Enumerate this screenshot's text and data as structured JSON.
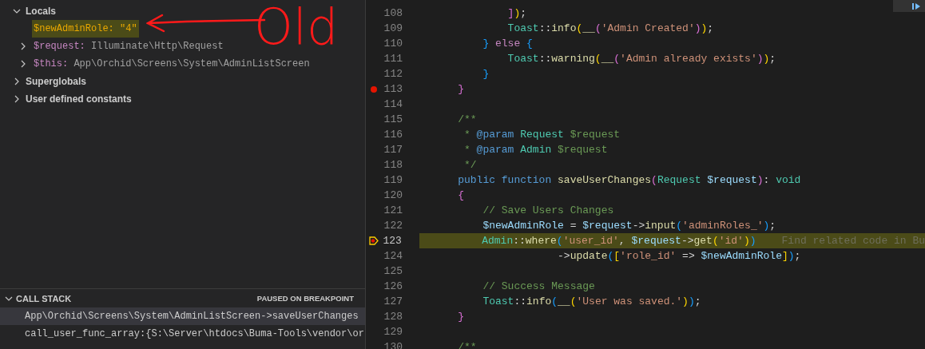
{
  "variables": {
    "sections": [
      {
        "label": "Locals",
        "expanded": true,
        "children": [
          {
            "name": "$newAdminRole:",
            "value": "\"4\"",
            "kind": "string",
            "expandable": false,
            "changed": true
          },
          {
            "name": "$request:",
            "value": "Illuminate\\Http\\Request",
            "kind": "object",
            "expandable": true,
            "changed": false
          },
          {
            "name": "$this:",
            "value": "App\\Orchid\\Screens\\System\\AdminListScreen",
            "kind": "object",
            "expandable": true,
            "changed": false
          }
        ]
      },
      {
        "label": "Superglobals",
        "expanded": false
      },
      {
        "label": "User defined constants",
        "expanded": false
      }
    ]
  },
  "annotation": {
    "text": "Old"
  },
  "call_stack": {
    "title": "CALL STACK",
    "expanded": true,
    "status": "PAUSED ON BREAKPOINT",
    "frames": [
      {
        "label": "App\\Orchid\\Screens\\System\\AdminListScreen->saveUserChanges",
        "selected": true
      },
      {
        "label": "call_user_func_array:{S:\\Server\\htdocs\\Buma-Tools\\vendor\\or",
        "selected": false
      }
    ]
  },
  "editor": {
    "lines": [
      {
        "number": "108",
        "current": false,
        "tokens": [
          {
            "kind": "b2",
            "text": "            ]"
          },
          {
            "kind": "b1",
            "text": ")"
          },
          {
            "kind": "p",
            "text": ";"
          }
        ]
      },
      {
        "number": "109",
        "current": false,
        "tokens": [
          {
            "kind": "cls",
            "text": "            Toast"
          },
          {
            "kind": "p",
            "text": "::"
          },
          {
            "kind": "fn",
            "text": "info"
          },
          {
            "kind": "b1",
            "text": "("
          },
          {
            "kind": "fn",
            "text": "__"
          },
          {
            "kind": "b2",
            "text": "("
          },
          {
            "kind": "str",
            "text": "'Admin Created'"
          },
          {
            "kind": "b2",
            "text": ")"
          },
          {
            "kind": "b1",
            "text": ")"
          },
          {
            "kind": "p",
            "text": ";"
          }
        ]
      },
      {
        "number": "110",
        "current": false,
        "tokens": [
          {
            "kind": "b3",
            "text": "        }"
          },
          {
            "kind": "kw2",
            "text": " else"
          },
          {
            "kind": "b3",
            "text": " {"
          }
        ]
      },
      {
        "number": "111",
        "current": false,
        "tokens": [
          {
            "kind": "cls",
            "text": "            Toast"
          },
          {
            "kind": "p",
            "text": "::"
          },
          {
            "kind": "fn",
            "text": "warning"
          },
          {
            "kind": "b1",
            "text": "("
          },
          {
            "kind": "fn",
            "text": "__"
          },
          {
            "kind": "b2",
            "text": "("
          },
          {
            "kind": "str",
            "text": "'Admin already exists'"
          },
          {
            "kind": "b2",
            "text": ")"
          },
          {
            "kind": "b1",
            "text": ")"
          },
          {
            "kind": "p",
            "text": ";"
          }
        ]
      },
      {
        "number": "112",
        "current": false,
        "tokens": [
          {
            "kind": "b3",
            "text": "        }"
          }
        ]
      },
      {
        "number": "113",
        "current": false,
        "kind": "breakpoint",
        "tokens": [
          {
            "kind": "b2",
            "text": "    }"
          }
        ]
      },
      {
        "number": "114",
        "current": false
      },
      {
        "number": "115",
        "current": false,
        "tokens": [
          {
            "kind": "cm",
            "text": "    /**"
          }
        ]
      },
      {
        "number": "116",
        "current": false,
        "tokens": [
          {
            "kind": "cm",
            "text": "     * "
          },
          {
            "kind": "kw",
            "text": "@param"
          },
          {
            "kind": "dt",
            "text": " Request"
          },
          {
            "kind": "cm",
            "text": " $request"
          }
        ]
      },
      {
        "number": "117",
        "current": false,
        "tokens": [
          {
            "kind": "cm",
            "text": "     * "
          },
          {
            "kind": "kw",
            "text": "@param"
          },
          {
            "kind": "dt",
            "text": " Admin"
          },
          {
            "kind": "cm",
            "text": " $request"
          }
        ]
      },
      {
        "number": "118",
        "current": false,
        "tokens": [
          {
            "kind": "cm",
            "text": "     */"
          }
        ]
      },
      {
        "number": "119",
        "current": false,
        "tokens": [
          {
            "kind": "kw",
            "text": "    public function"
          },
          {
            "kind": "fn",
            "text": " saveUserChanges"
          },
          {
            "kind": "b2",
            "text": "("
          },
          {
            "kind": "cls",
            "text": "Request"
          },
          {
            "kind": "var",
            "text": " $request"
          },
          {
            "kind": "b2",
            "text": ")"
          },
          {
            "kind": "p",
            "text": ":"
          },
          {
            "kind": "cls",
            "text": " void"
          }
        ]
      },
      {
        "number": "120",
        "current": false,
        "tokens": [
          {
            "kind": "b2",
            "text": "    {"
          }
        ]
      },
      {
        "number": "121",
        "current": false,
        "tokens": [
          {
            "kind": "cm",
            "text": "        // Save Users Changes"
          }
        ]
      },
      {
        "number": "122",
        "current": false,
        "tokens": [
          {
            "kind": "var",
            "text": "        $newAdminRole"
          },
          {
            "kind": "p",
            "text": " = "
          },
          {
            "kind": "var",
            "text": "$request"
          },
          {
            "kind": "p",
            "text": "->"
          },
          {
            "kind": "fn",
            "text": "input"
          },
          {
            "kind": "b3",
            "text": "("
          },
          {
            "kind": "str",
            "text": "'adminRoles_'"
          },
          {
            "kind": "b3",
            "text": ")"
          },
          {
            "kind": "p",
            "text": ";"
          }
        ]
      },
      {
        "number": "123",
        "current": true,
        "kind": "paused",
        "hint": "Find related code in Bu",
        "tokens": [
          {
            "kind": "cls",
            "text": "        Admin"
          },
          {
            "kind": "p",
            "text": "::"
          },
          {
            "kind": "fn",
            "text": "where"
          },
          {
            "kind": "b3",
            "text": "("
          },
          {
            "kind": "str",
            "text": "'user_id'"
          },
          {
            "kind": "p",
            "text": ","
          },
          {
            "kind": "var",
            "text": " $request"
          },
          {
            "kind": "p",
            "text": "->"
          },
          {
            "kind": "fn",
            "text": "get"
          },
          {
            "kind": "b1",
            "text": "("
          },
          {
            "kind": "str",
            "text": "'id'"
          },
          {
            "kind": "b1",
            "text": ")"
          },
          {
            "kind": "b3",
            "text": ")"
          }
        ]
      },
      {
        "number": "124",
        "current": false,
        "tokens": [
          {
            "kind": "p",
            "text": "                    ->"
          },
          {
            "kind": "fn",
            "text": "update"
          },
          {
            "kind": "b3",
            "text": "("
          },
          {
            "kind": "b1",
            "text": "["
          },
          {
            "kind": "str",
            "text": "'role_id'"
          },
          {
            "kind": "p",
            "text": " => "
          },
          {
            "kind": "var",
            "text": "$newAdminRole"
          },
          {
            "kind": "b1",
            "text": "]"
          },
          {
            "kind": "b3",
            "text": ")"
          },
          {
            "kind": "p",
            "text": ";"
          }
        ]
      },
      {
        "number": "125",
        "current": false
      },
      {
        "number": "126",
        "current": false,
        "tokens": [
          {
            "kind": "cm",
            "text": "        // Success Message"
          }
        ]
      },
      {
        "number": "127",
        "current": false,
        "tokens": [
          {
            "kind": "cls",
            "text": "        Toast"
          },
          {
            "kind": "p",
            "text": "::"
          },
          {
            "kind": "fn",
            "text": "info"
          },
          {
            "kind": "b3",
            "text": "("
          },
          {
            "kind": "fn",
            "text": "__"
          },
          {
            "kind": "b1",
            "text": "("
          },
          {
            "kind": "str",
            "text": "'User was saved.'"
          },
          {
            "kind": "b1",
            "text": ")"
          },
          {
            "kind": "b3",
            "text": ")"
          },
          {
            "kind": "p",
            "text": ";"
          }
        ]
      },
      {
        "number": "128",
        "current": false,
        "tokens": [
          {
            "kind": "b2",
            "text": "    }"
          }
        ]
      },
      {
        "number": "129",
        "current": false
      },
      {
        "number": "130",
        "current": false,
        "tokens": [
          {
            "kind": "cm",
            "text": "    /**"
          }
        ]
      }
    ]
  }
}
